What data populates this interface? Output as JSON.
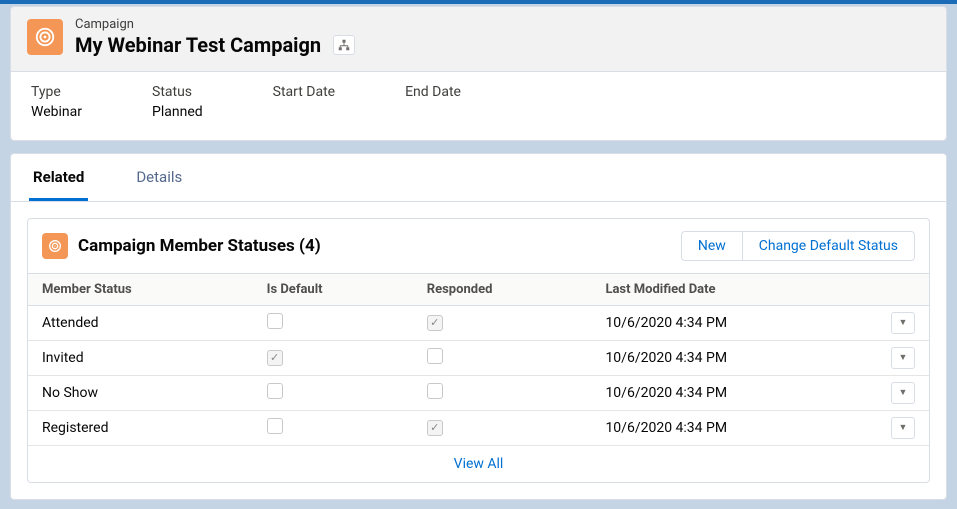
{
  "header": {
    "object_label": "Campaign",
    "title": "My Webinar Test Campaign",
    "fields": [
      {
        "label": "Type",
        "value": "Webinar"
      },
      {
        "label": "Status",
        "value": "Planned"
      },
      {
        "label": "Start Date",
        "value": ""
      },
      {
        "label": "End Date",
        "value": ""
      }
    ]
  },
  "tabs": {
    "related": "Related",
    "details": "Details",
    "active": "related"
  },
  "related_list": {
    "title": "Campaign Member Statuses (4)",
    "buttons": {
      "new": "New",
      "change_default": "Change Default Status"
    },
    "columns": [
      "Member Status",
      "Is Default",
      "Responded",
      "Last Modified Date"
    ],
    "rows": [
      {
        "status": "Attended",
        "is_default": false,
        "responded": true,
        "modified": "10/6/2020 4:34 PM"
      },
      {
        "status": "Invited",
        "is_default": true,
        "responded": false,
        "modified": "10/6/2020 4:34 PM"
      },
      {
        "status": "No Show",
        "is_default": false,
        "responded": false,
        "modified": "10/6/2020 4:34 PM"
      },
      {
        "status": "Registered",
        "is_default": false,
        "responded": true,
        "modified": "10/6/2020 4:34 PM"
      }
    ],
    "view_all": "View All"
  }
}
